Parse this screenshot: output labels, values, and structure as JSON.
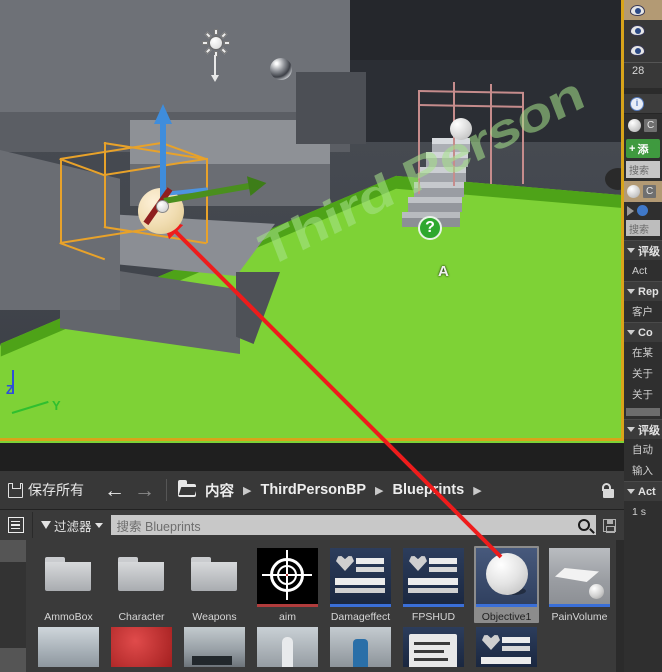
{
  "viewport": {
    "floor_text": "Third Person",
    "char_marker": "A",
    "question_marker": "?",
    "axis_z_label": "Z",
    "axis_y_label": "Y",
    "colors": {
      "floor_green": "#7ed236",
      "gizmo_z_blue": "#3f8ddc",
      "gizmo_y_green": "#4a8f1e",
      "gizmo_x_red": "#8f1f1f",
      "selection_orange": "#e8a22a",
      "trigger_pink": "#c68c8c",
      "viewport_border": "#d8a41a",
      "annotation_red": "#ee1c1c"
    }
  },
  "content_browser": {
    "toolbar": {
      "save_all_label": "保存所有",
      "save_icon": "save-icon",
      "back_arrow": "←",
      "forward_arrow": "→",
      "folder_icon": "folder-icon",
      "lock_icon": "lock-icon",
      "breadcrumbs": [
        {
          "label": "内容",
          "sep": "▶"
        },
        {
          "label": "ThirdPersonBP",
          "sep": "▶"
        },
        {
          "label": "Blueprints",
          "sep": "▶"
        }
      ]
    },
    "filterbar": {
      "list_icon": "list-view-icon",
      "filters_label": "过滤器",
      "funnel_icon": "funnel-icon",
      "caret_icon": "chevron-down-icon",
      "search_placeholder": "搜索 Blueprints",
      "search_value": "",
      "magnifier_icon": "search-icon",
      "disk_icon": "save-search-icon"
    },
    "assets": [
      {
        "name": "AmmoBox",
        "thumb": "folder",
        "strip": "none",
        "selected": false
      },
      {
        "name": "Character",
        "thumb": "folder",
        "strip": "none",
        "selected": false
      },
      {
        "name": "Weapons",
        "thumb": "folder",
        "strip": "none",
        "selected": false
      },
      {
        "name": "aim",
        "thumb": "aim",
        "strip": "red",
        "selected": false
      },
      {
        "name": "Damageffect",
        "thumb": "hud",
        "strip": "blue",
        "selected": false
      },
      {
        "name": "FPSHUD",
        "thumb": "hud",
        "strip": "blue",
        "selected": false
      },
      {
        "name": "Objective1",
        "thumb": "obj",
        "strip": "blue",
        "selected": true
      },
      {
        "name": "PainVolume",
        "thumb": "pv",
        "strip": "blue",
        "selected": false
      }
    ],
    "assets_row2": [
      {
        "thumb": "ice"
      },
      {
        "thumb": "red"
      },
      {
        "thumb": "land"
      },
      {
        "thumb": "man"
      },
      {
        "thumb": "robot"
      },
      {
        "thumb": "bpclass"
      },
      {
        "thumb": "hud"
      }
    ]
  },
  "right_panel": {
    "outliner": {
      "eye_icon": "eye-icon",
      "rows": [
        {
          "icon": "eye-icon",
          "selected": true
        },
        {
          "icon": "eye-icon",
          "selected": false
        },
        {
          "icon": "eye-icon",
          "selected": false
        }
      ],
      "count_text": "28"
    },
    "details": {
      "info_icon": "info-search-icon",
      "sphere_label": "C",
      "add_button_label": "添",
      "add_button_plus": "+",
      "add_button_color": "#3f9a3f",
      "search_placeholder": "搜索",
      "selected_actor_label": "C",
      "search2_placeholder": "搜索",
      "categories": [
        {
          "label": "评级",
          "props": [
            "Act"
          ]
        },
        {
          "label": "Rep",
          "props": [
            "客户"
          ]
        },
        {
          "label": "Co",
          "props": [
            "在某",
            "关于",
            "关于"
          ]
        },
        {
          "label": "评级",
          "props": [
            "自动",
            "输入"
          ]
        },
        {
          "label": "Act",
          "props": [
            "1 s"
          ]
        }
      ]
    }
  }
}
